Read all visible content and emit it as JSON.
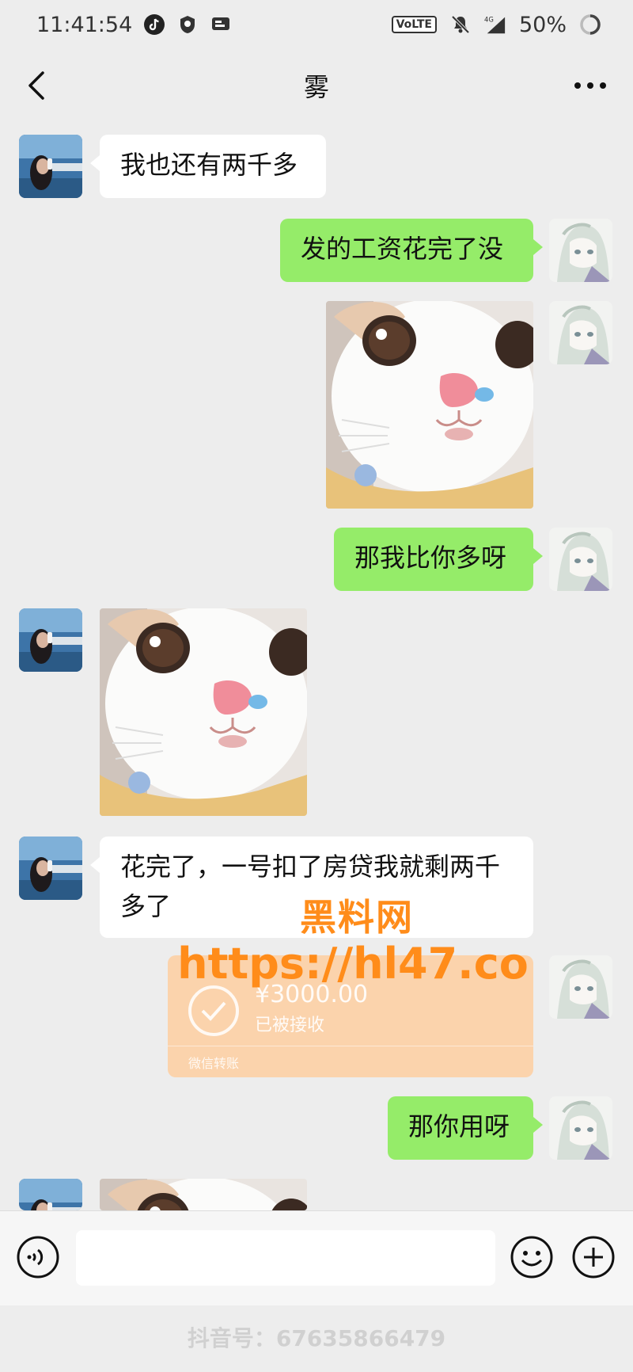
{
  "status_bar": {
    "time": "11:41:54",
    "network": "VoLTE",
    "signal": "4G",
    "battery": "50%"
  },
  "nav": {
    "title": "雾"
  },
  "messages": [
    {
      "side": "left",
      "type": "text",
      "text": "我也还有两千多"
    },
    {
      "side": "right",
      "type": "text",
      "text": "发的工资花完了没"
    },
    {
      "side": "right",
      "type": "sticker",
      "sticker": "crying-cat"
    },
    {
      "side": "right",
      "type": "text",
      "text": "那我比你多呀"
    },
    {
      "side": "left",
      "type": "sticker",
      "sticker": "crying-cat"
    },
    {
      "side": "left",
      "type": "text",
      "line1": "花完了，一号扣了房贷我就剩两千",
      "line2": "多了"
    },
    {
      "side": "right",
      "type": "transfer",
      "amount": "¥3000.00",
      "status": "已被接收",
      "footer": "微信转账"
    },
    {
      "side": "right",
      "type": "text",
      "text": "那你用呀"
    },
    {
      "side": "left",
      "type": "sticker",
      "sticker": "crying-cat"
    }
  ],
  "watermark": {
    "line1": "黑料网",
    "line2": "https://hl47.co"
  },
  "input_bar": {
    "placeholder": ""
  },
  "footer_watermark": "抖音号：67635866479",
  "colors": {
    "background": "#ededed",
    "bubble_self": "#95ec69",
    "bubble_other": "#ffffff",
    "transfer_card": "#fbd3ac",
    "watermark": "#ff8c1a"
  }
}
